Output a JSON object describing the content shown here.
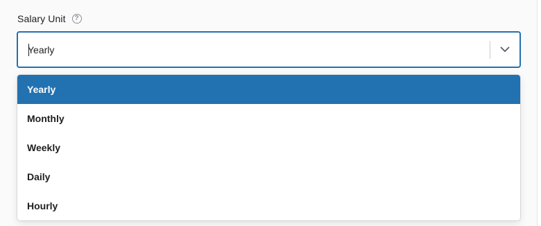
{
  "field": {
    "label": "Salary Unit",
    "help_icon": "question-circle-icon",
    "value": "Yearly"
  },
  "dropdown": {
    "toggle_icon": "chevron-down-icon",
    "accent_color": "#2271b1",
    "selected_index": 0,
    "options": [
      {
        "label": "Yearly"
      },
      {
        "label": "Monthly"
      },
      {
        "label": "Weekly"
      },
      {
        "label": "Daily"
      },
      {
        "label": "Hourly"
      }
    ]
  }
}
